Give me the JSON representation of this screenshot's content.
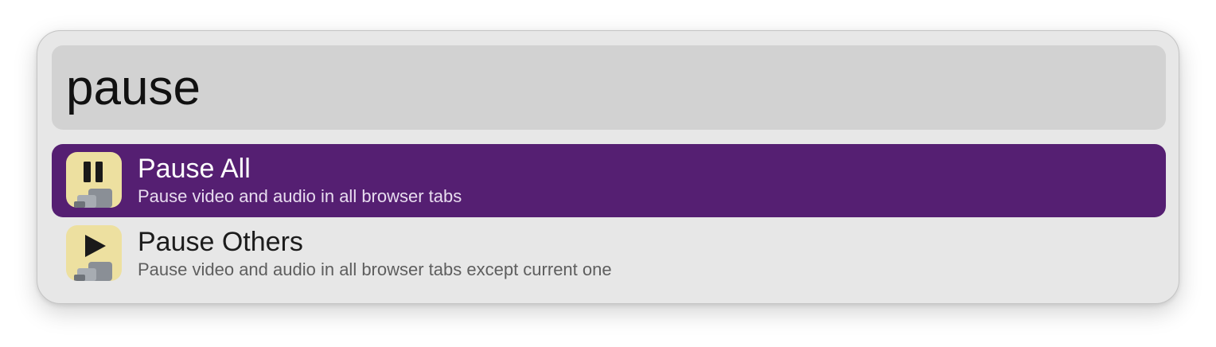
{
  "search": {
    "query": "pause"
  },
  "results": [
    {
      "title": "Pause All",
      "subtitle": "Pause video and audio in all browser tabs",
      "icon": "pause-icon",
      "selected": true
    },
    {
      "title": "Pause Others",
      "subtitle": "Pause video and audio in all browser tabs except current one",
      "icon": "play-icon",
      "selected": false
    }
  ],
  "colors": {
    "selection": "#551f72",
    "window_bg": "#e7e7e7",
    "search_bg": "#d2d2d2",
    "icon_bg": "#ede0a0"
  }
}
